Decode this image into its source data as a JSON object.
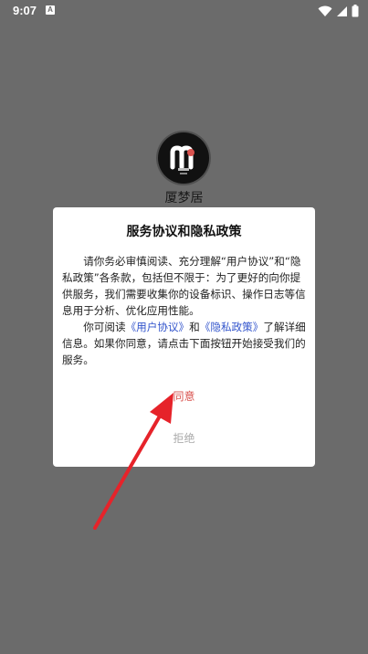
{
  "status_bar": {
    "time": "9:07",
    "notification_icon": "a-letter-notification-icon",
    "icons": [
      "wifi-icon",
      "signal-icon",
      "battery-icon"
    ]
  },
  "app": {
    "logo_icon": "app-logo-icon",
    "name": "厦梦居"
  },
  "dialog": {
    "title": "服务协议和隐私政策",
    "para1": "请你务必审慎阅读、充分理解“用户协议”和“隐私政策”各条款，包括但不限于：为了更好的向你提供服务，我们需要收集你的设备标识、操作日志等信息用于分析、优化应用性能。",
    "para2_before": "你可阅读",
    "user_agreement_link": "《用户协议》",
    "para2_and": "和",
    "privacy_policy_link": "《隐私政策》",
    "para2_after": "了解详细信息。如果你同意，请点击下面按钮开始接受我们的服务。",
    "agree_label": "同意",
    "reject_label": "拒绝"
  },
  "colors": {
    "overlay_background": "#6b6b6b",
    "dialog_background": "#ffffff",
    "link": "#3355cc",
    "agree": "#d9534f",
    "reject": "#aaaaaa",
    "annotation_arrow": "#e6232a"
  }
}
